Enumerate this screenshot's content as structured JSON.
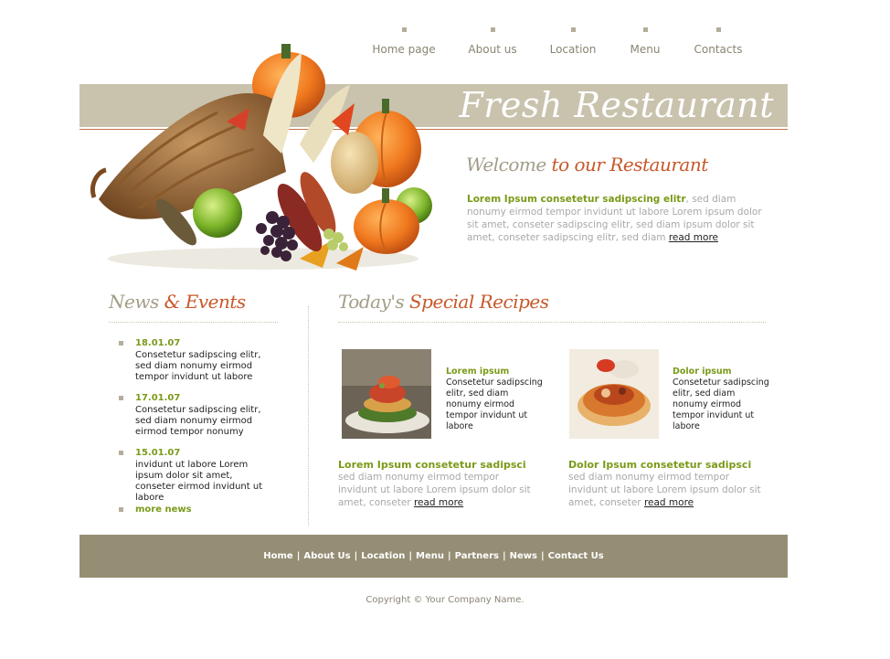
{
  "nav": {
    "items": [
      "Home page",
      "About us",
      "Location",
      "Menu",
      "Contacts"
    ]
  },
  "header": {
    "title": "Fresh Restaurant"
  },
  "welcome": {
    "heading_gray": "Welcome",
    "heading_orange": " to our Restaurant",
    "lead": "Lorem Ipsum consetetur sadipscing elitr",
    "text": ", sed diam nonumy eirmod tempor invidunt ut labore Lorem ipsum dolor sit amet, conseter sadipscing elitr, sed diam ipsum dolor sit amet, conseter sadipscing elitr, sed diam ",
    "read_more": "read more"
  },
  "news": {
    "heading_gray": "News",
    "heading_orange": " & Events",
    "items": [
      {
        "date": "18.01.07",
        "text": "Consetetur sadipscing elitr, sed diam nonumy eirmod tempor invidunt ut labore"
      },
      {
        "date": "17.01.07",
        "text": "Consetetur sadipscing elitr, sed diam nonumy eirmod eirmod tempor nonumy"
      },
      {
        "date": "15.01.07",
        "text": "invidunt ut labore Lorem ipsum dolor sit amet, conseter eirmod invidunt ut labore"
      }
    ],
    "more": "more news"
  },
  "recipes": {
    "heading_gray": "Today's",
    "heading_orange": " Special Recipes",
    "cards": [
      {
        "title": "Lorem ipsum",
        "text": "Consetetur sadipscing elitr, sed diam nonumy eirmod tempor invidunt ut labore"
      },
      {
        "title": "Dolor ipsum",
        "text": "Consetetur sadipscing elitr, sed diam nonumy eirmod tempor invidunt ut labore"
      }
    ],
    "blurbs": [
      {
        "heading": "Lorem Ipsum consetetur sadipsci",
        "text": "sed diam nonumy eirmod tempor invidunt ut labore Lorem ipsum dolor sit amet, conseter ",
        "read_more": "read more"
      },
      {
        "heading": "Dolor Ipsum consetetur sadipsci",
        "text": "sed diam nonumy eirmod tempor invidunt ut labore Lorem ipsum dolor sit amet, conseter ",
        "read_more": "read more"
      }
    ]
  },
  "footer": {
    "links": [
      "Home",
      "About Us",
      "Location",
      "Menu",
      "Partners",
      "News",
      "Contact Us"
    ],
    "separator": "|",
    "copyright": "Copyright © Your Company Name."
  },
  "colors": {
    "accent_green": "#7a9a18",
    "accent_orange": "#c8582a",
    "band": "#c9c3ae",
    "footer": "#958d74"
  }
}
